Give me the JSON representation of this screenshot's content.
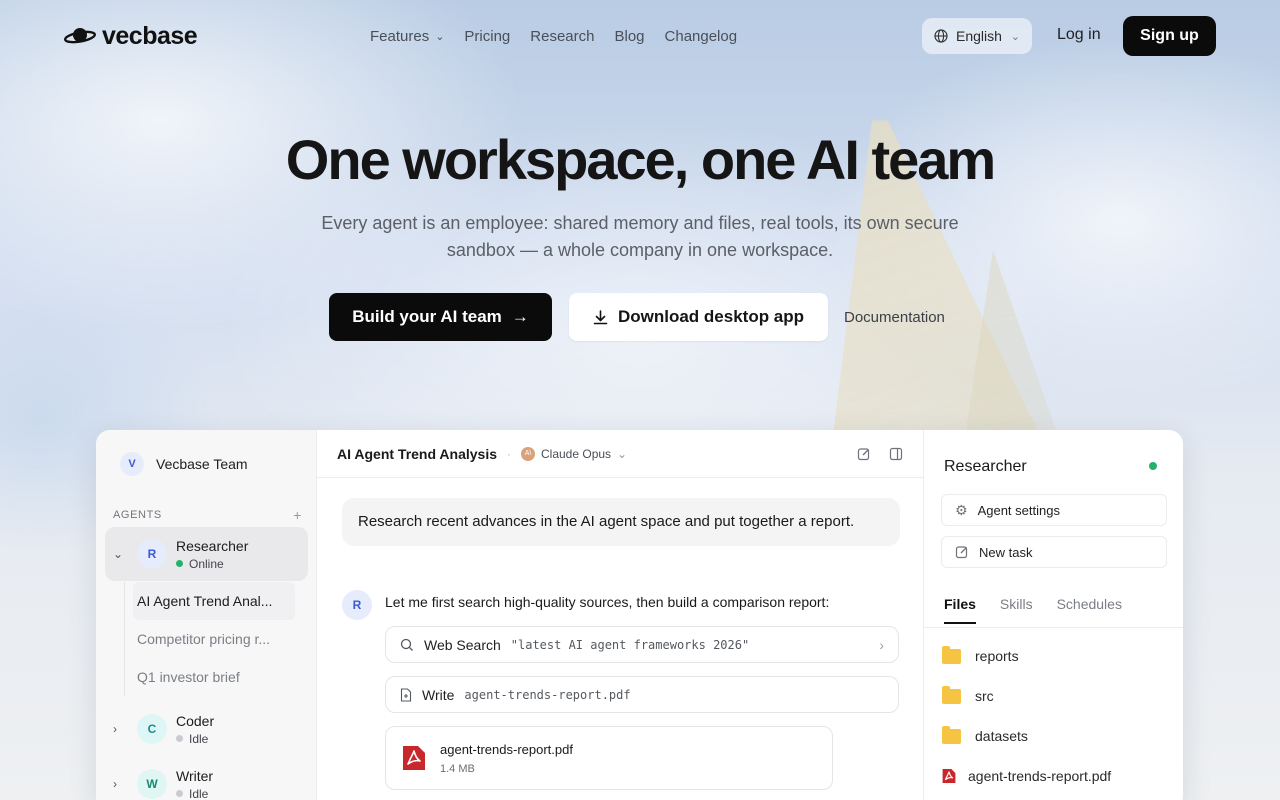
{
  "nav": {
    "brand": "vecbase",
    "items": [
      {
        "label": "Features",
        "has_dropdown": true
      },
      {
        "label": "Pricing"
      },
      {
        "label": "Research"
      },
      {
        "label": "Blog"
      },
      {
        "label": "Changelog"
      }
    ],
    "language": "English",
    "login": "Log in",
    "signup": "Sign up"
  },
  "hero": {
    "title": "One workspace, one AI team",
    "subtitle": "Every agent is an employee: shared memory and files, real tools, its own secure sandbox — a whole company in one workspace.",
    "cta_primary": "Build your AI team",
    "cta_secondary": "Download desktop app",
    "cta_docs": "Documentation"
  },
  "app": {
    "sidebar": {
      "team_initial": "V",
      "team_name": "Vecbase Team",
      "agents_heading": "AGENTS",
      "agents": [
        {
          "initial": "R",
          "name": "Researcher",
          "status": "Online",
          "expanded": true
        },
        {
          "initial": "C",
          "name": "Coder",
          "status": "Idle"
        },
        {
          "initial": "W",
          "name": "Writer",
          "status": "Idle"
        }
      ],
      "threads": [
        "AI Agent Trend Anal...",
        "Competitor pricing r...",
        "Q1 investor brief"
      ]
    },
    "chat": {
      "title": "AI Agent Trend Analysis",
      "model_initial": "A\\",
      "model": "Claude Opus",
      "user_message": "Research recent advances in the AI agent space and put together a report.",
      "bot_initial": "R",
      "bot_message": "Let me first search high-quality sources, then build a comparison report:",
      "tools": [
        {
          "name": "Web Search",
          "arg": "\"latest AI agent frameworks 2026\""
        },
        {
          "name": "Write",
          "arg": "agent-trends-report.pdf"
        }
      ],
      "file": {
        "name": "agent-trends-report.pdf",
        "size": "1.4 MB"
      }
    },
    "panel": {
      "title": "Researcher",
      "status_color": "#23b26d",
      "buttons": [
        "Agent settings",
        "New task"
      ],
      "tabs": [
        "Files",
        "Skills",
        "Schedules"
      ],
      "active_tab": "Files",
      "files": [
        {
          "name": "reports",
          "type": "folder"
        },
        {
          "name": "src",
          "type": "folder"
        },
        {
          "name": "datasets",
          "type": "folder"
        },
        {
          "name": "agent-trends-report.pdf",
          "type": "pdf"
        }
      ]
    }
  },
  "colors": {
    "accent_dark": "#0b0b0c",
    "online": "#23b26d",
    "folder": "#f6c443",
    "pdf": "#c8282c"
  }
}
